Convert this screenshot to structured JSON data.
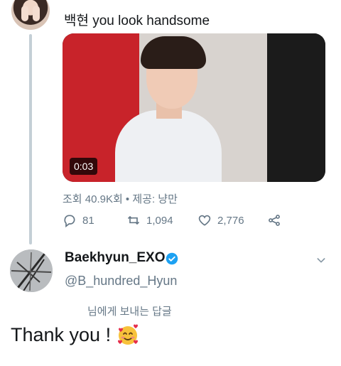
{
  "quoted": {
    "text": "백현 you look handsome",
    "video_duration": "0:03",
    "stats": "조회 40.9K회 • 제공: 냥만"
  },
  "actions": {
    "reply_count": "81",
    "retweet_count": "1,094",
    "like_count": "2,776"
  },
  "reply": {
    "display_name": "Baekhyun_EXO",
    "handle": "@B_hundred_Hyun",
    "reply_to": "님에게 보내는 답글",
    "text": "Thank you !"
  },
  "colors": {
    "verified": "#1da1f2",
    "muted": "#657786",
    "thread_line": "#c4cfd6"
  }
}
